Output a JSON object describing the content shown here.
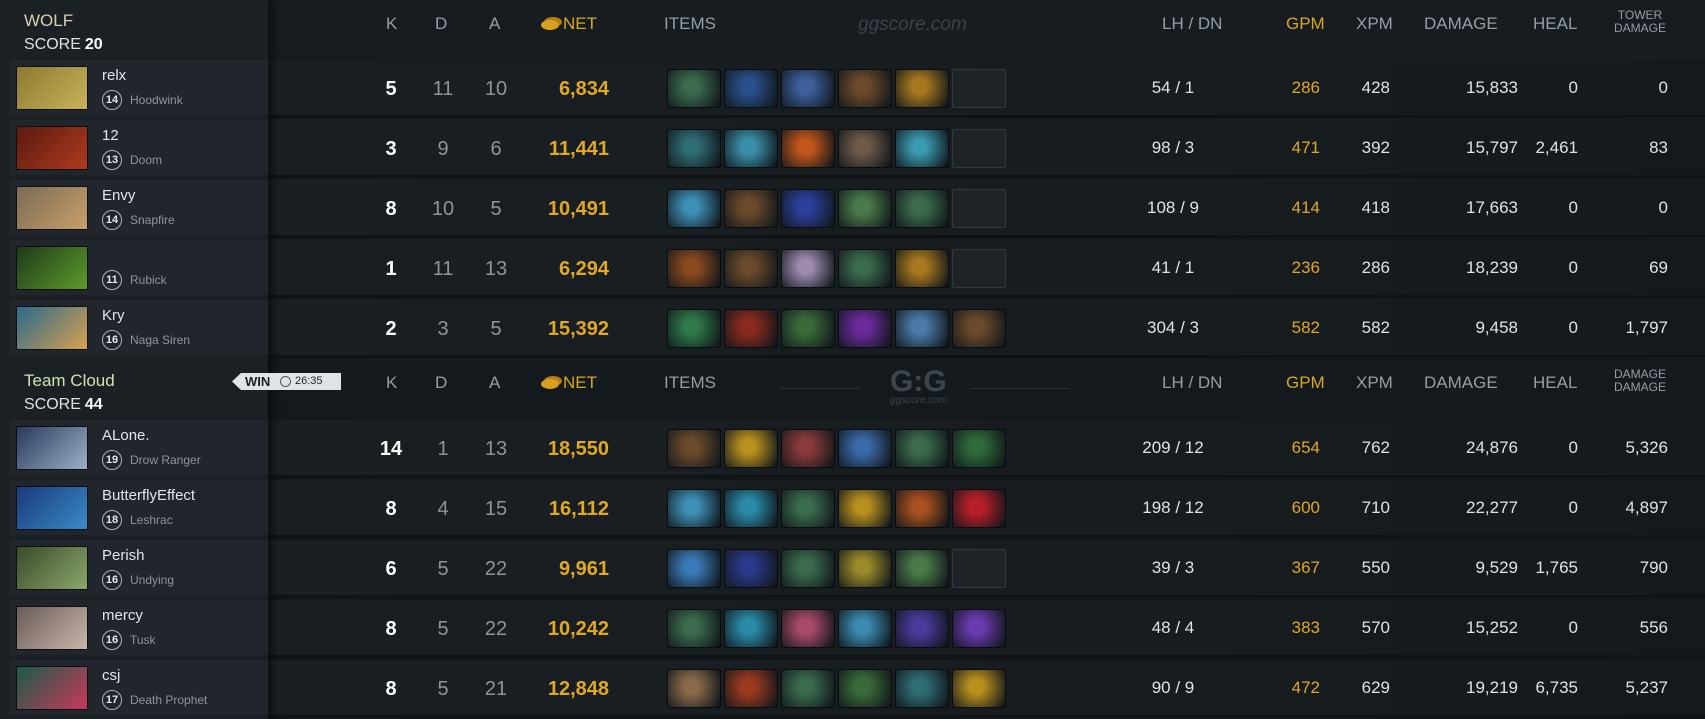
{
  "watermark": "ggscore.com",
  "watermark2": "G:G",
  "columns": {
    "k": "K",
    "d": "D",
    "a": "A",
    "net": "NET",
    "items": "ITEMS",
    "lhdn": "LH  /  DN",
    "gpm": "GPM",
    "xpm": "XPM",
    "damage": "DAMAGE",
    "heal": "HEAL",
    "tower_damage_1": "TOWER",
    "tower_damage_2": "DAMAGE"
  },
  "result": {
    "label": "WIN",
    "duration": "26:35"
  },
  "teams": [
    {
      "name": "WOLF",
      "score_label": "SCORE",
      "score": "20",
      "players": [
        {
          "name": "relx",
          "level": "14",
          "hero": "Hoodwink",
          "k": "5",
          "d": "11",
          "a": "10",
          "net": "6,834",
          "lhdn": "54  /  1",
          "gpm": "286",
          "xpm": "428",
          "damage": "15,833",
          "heal": "0",
          "tower": "0",
          "portrait_colors": [
            "#8a7a30",
            "#c9b25a"
          ],
          "items": [
            "#3b6b4e",
            "#2a4f8a",
            "#3d5f9c",
            "#6b4a2b",
            "#a8781e",
            "empty"
          ]
        },
        {
          "name": "12",
          "level": "13",
          "hero": "Doom",
          "k": "3",
          "d": "9",
          "a": "6",
          "net": "11,441",
          "lhdn": "98  /  3",
          "gpm": "471",
          "xpm": "392",
          "damage": "15,797",
          "heal": "2,461",
          "tower": "83",
          "portrait_colors": [
            "#5a1a10",
            "#b03a1e"
          ],
          "items": [
            "#2e6d73",
            "#3a8fa8",
            "#c2561c",
            "#6e5a48",
            "#3a9ab0",
            "empty"
          ]
        },
        {
          "name": "Envy",
          "level": "14",
          "hero": "Snapfire",
          "k": "8",
          "d": "10",
          "a": "5",
          "net": "10,491",
          "lhdn": "108  /  9",
          "gpm": "414",
          "xpm": "418",
          "damage": "17,663",
          "heal": "0",
          "tower": "0",
          "portrait_colors": [
            "#7a6a55",
            "#c8a06a"
          ],
          "items": [
            "#3e8fb5",
            "#6b4a2b",
            "#2c3f9c",
            "#4a7a4a",
            "#3b6b4e",
            "empty"
          ]
        },
        {
          "name": "",
          "level": "11",
          "hero": "Rubick",
          "k": "1",
          "d": "11",
          "a": "13",
          "net": "6,294",
          "lhdn": "41  /  1",
          "gpm": "236",
          "xpm": "286",
          "damage": "18,239",
          "heal": "0",
          "tower": "69",
          "portrait_colors": [
            "#1d3a1a",
            "#5e9a2a"
          ],
          "items": [
            "#8a4a1e",
            "#6b4a2b",
            "#9c8ab0",
            "#3b6b4e",
            "#a8781e",
            "empty"
          ]
        },
        {
          "name": "Kry",
          "level": "16",
          "hero": "Naga Siren",
          "k": "2",
          "d": "3",
          "a": "5",
          "net": "15,392",
          "lhdn": "304  /  3",
          "gpm": "582",
          "xpm": "582",
          "damage": "9,458",
          "heal": "0",
          "tower": "1,797",
          "portrait_colors": [
            "#2a6a8a",
            "#d8a050"
          ],
          "items": [
            "#2e7a4a",
            "#8a2a1e",
            "#3a6a3a",
            "#6a2a9c",
            "#4a7aa8",
            "#6b4a2b"
          ]
        }
      ]
    },
    {
      "name": "Team Cloud",
      "score_label": "SCORE",
      "score": "44",
      "players": [
        {
          "name": "ALone.",
          "level": "19",
          "hero": "Drow Ranger",
          "k": "14",
          "d": "1",
          "a": "13",
          "net": "18,550",
          "lhdn": "209  /  12",
          "gpm": "654",
          "xpm": "762",
          "damage": "24,876",
          "heal": "0",
          "tower": "5,326",
          "portrait_colors": [
            "#2a3a5a",
            "#9ab0c8"
          ],
          "items": [
            "#6b4a2b",
            "#b8901e",
            "#8a3a3a",
            "#3a6aa8",
            "#3b6b4e",
            "#2e6a3a"
          ]
        },
        {
          "name": "ButterflyEffect",
          "level": "18",
          "hero": "Leshrac",
          "k": "8",
          "d": "4",
          "a": "15",
          "net": "16,112",
          "lhdn": "198  /  12",
          "gpm": "600",
          "xpm": "710",
          "damage": "22,277",
          "heal": "0",
          "tower": "4,897",
          "portrait_colors": [
            "#1a3a7a",
            "#3a8ac8"
          ],
          "items": [
            "#3e8fb5",
            "#2a8aa8",
            "#3b6b4e",
            "#b8901e",
            "#a8501e",
            "#b81e2a"
          ]
        },
        {
          "name": "Perish",
          "level": "16",
          "hero": "Undying",
          "k": "6",
          "d": "5",
          "a": "22",
          "net": "9,961",
          "lhdn": "39  /  3",
          "gpm": "367",
          "xpm": "550",
          "damage": "9,529",
          "heal": "1,765",
          "tower": "790",
          "portrait_colors": [
            "#3a4a2a",
            "#8aa86a"
          ],
          "items": [
            "#3a7ab8",
            "#2a3a8a",
            "#3b6b4e",
            "#9a8a2a",
            "#4a7a4a",
            "empty"
          ]
        },
        {
          "name": "mercy",
          "level": "16",
          "hero": "Tusk",
          "k": "8",
          "d": "5",
          "a": "22",
          "net": "10,242",
          "lhdn": "48  /  4",
          "gpm": "383",
          "xpm": "570",
          "damage": "15,252",
          "heal": "0",
          "tower": "556",
          "portrait_colors": [
            "#6a5a5a",
            "#c8b8a8"
          ],
          "items": [
            "#3b6b4e",
            "#2a8aa8",
            "#a84a6a",
            "#3a8ab0",
            "#4a3a9c",
            "#6a3ab0"
          ]
        },
        {
          "name": "csj",
          "level": "17",
          "hero": "Death Prophet",
          "k": "8",
          "d": "5",
          "a": "21",
          "net": "12,848",
          "lhdn": "90  /  9",
          "gpm": "472",
          "xpm": "629",
          "damage": "19,219",
          "heal": "6,735",
          "tower": "5,237",
          "portrait_colors": [
            "#1a5a4a",
            "#c83a5a"
          ],
          "items": [
            "#8a6a4a",
            "#9a3a1e",
            "#3b6b4e",
            "#3a6a3a",
            "#2e6d73",
            "#b8901e"
          ]
        }
      ]
    }
  ]
}
